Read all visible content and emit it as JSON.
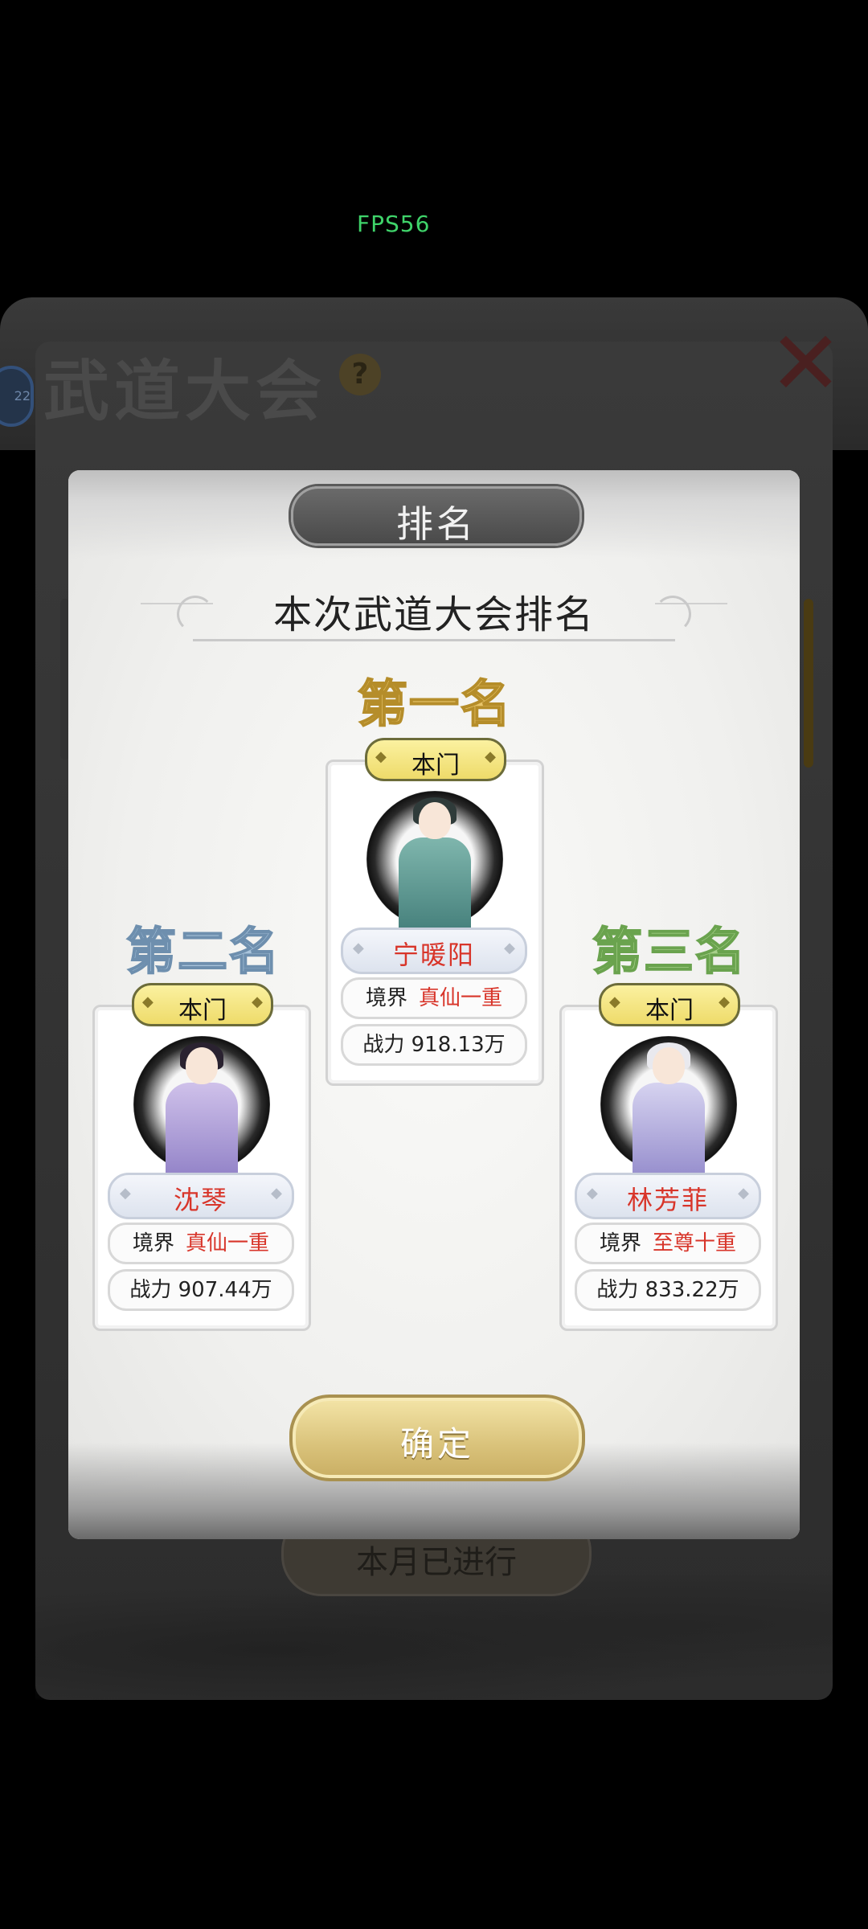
{
  "fps": "FPS56",
  "background": {
    "title": "武道大会",
    "help_symbol": "?",
    "close_symbol": "✕",
    "avatar_text": "22",
    "month_button": "本月已进行"
  },
  "dialog": {
    "title": "排名",
    "subtitle": "本次武道大会排名",
    "confirm_label": "确定",
    "podium": [
      {
        "rank_label": "第一名",
        "tag": "本门",
        "name": "宁暖阳",
        "realm_label": "境界",
        "realm_value": "真仙一重",
        "power_text": "战力 918.13万"
      },
      {
        "rank_label": "第二名",
        "tag": "本门",
        "name": "沈琴",
        "realm_label": "境界",
        "realm_value": "真仙一重",
        "power_text": "战力 907.44万"
      },
      {
        "rank_label": "第三名",
        "tag": "本门",
        "name": "林芳菲",
        "realm_label": "境界",
        "realm_value": "至尊十重",
        "power_text": "战力 833.22万"
      }
    ]
  },
  "colors": {
    "rank1": "#e8c56a",
    "rank2": "#a9c4dc",
    "rank3": "#a7d08a",
    "name_red": "#d8352a",
    "fps_green": "#3fd36a"
  }
}
